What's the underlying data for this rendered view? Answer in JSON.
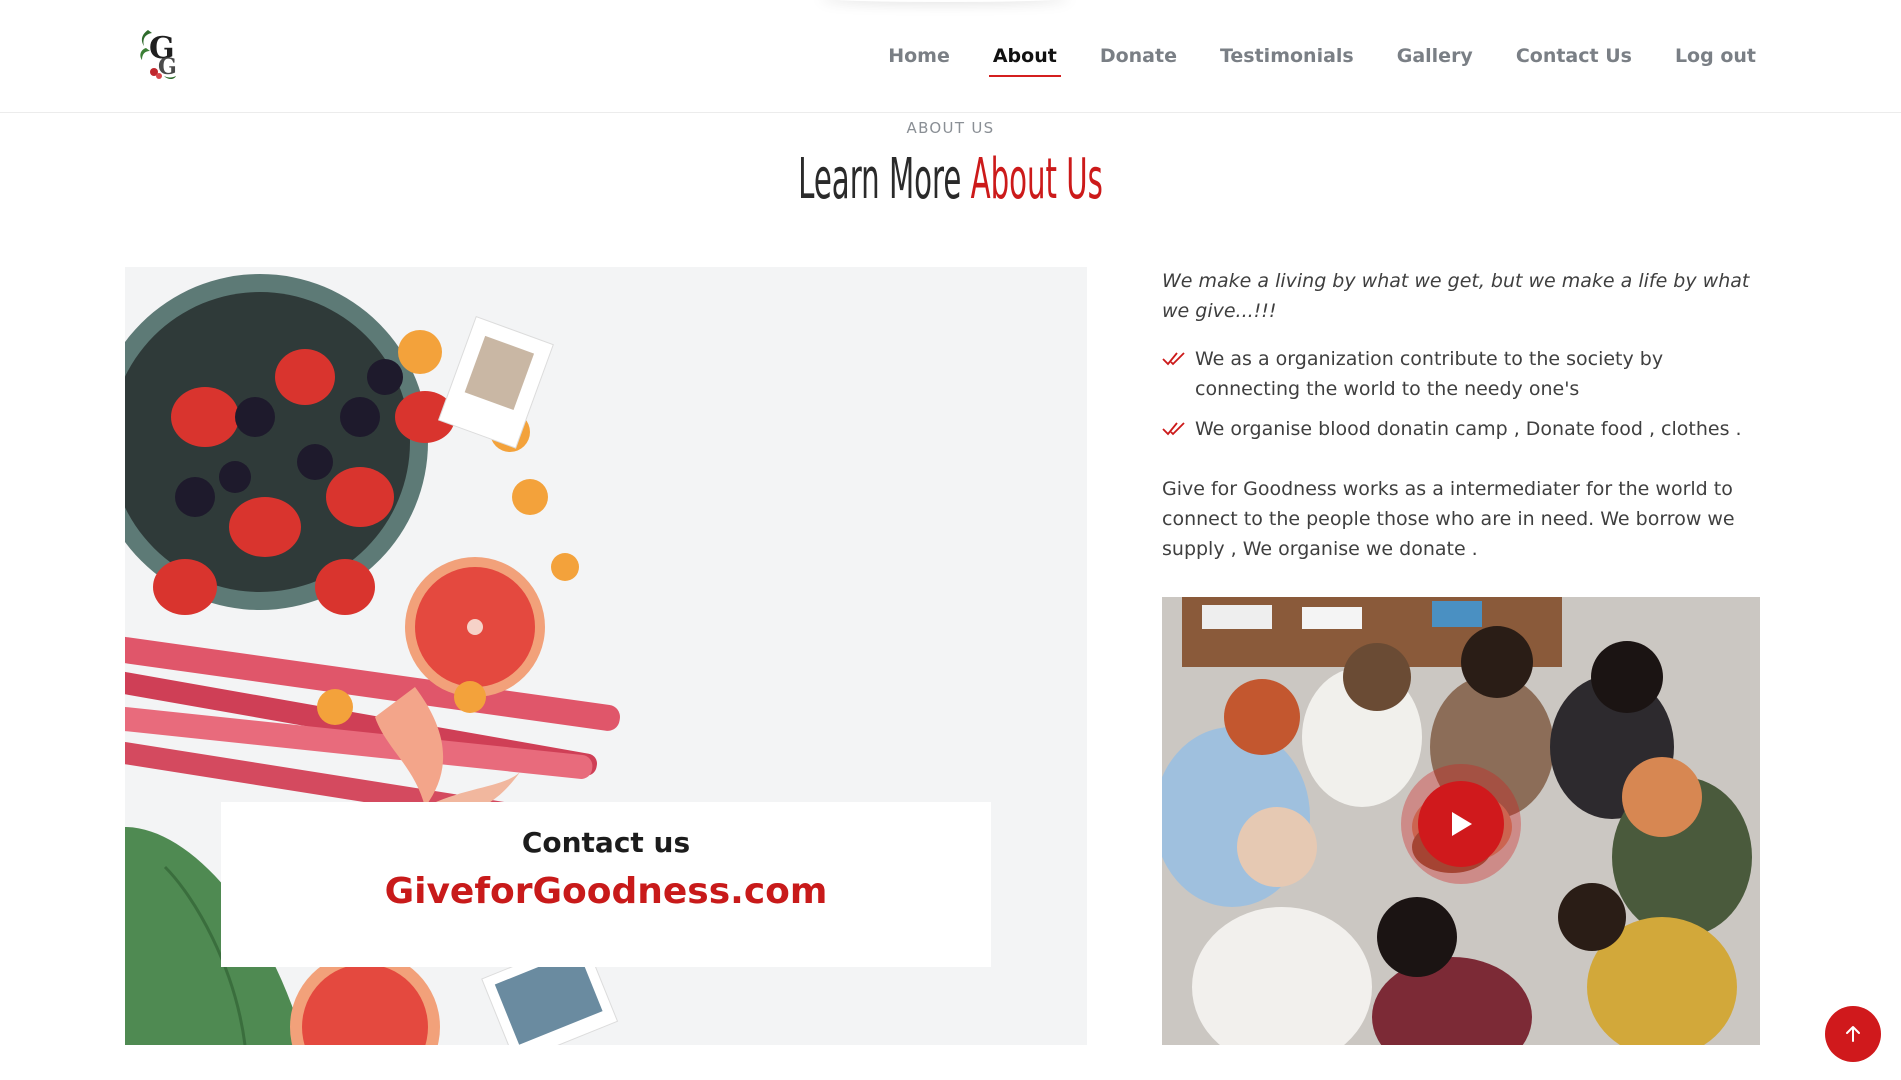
{
  "header": {
    "logo_icon": "leaf-G-monogram-icon",
    "nav": [
      {
        "label": "Home",
        "active": false
      },
      {
        "label": "About",
        "active": true
      },
      {
        "label": "Donate",
        "active": false
      },
      {
        "label": "Testimonials",
        "active": false
      },
      {
        "label": "Gallery",
        "active": false
      },
      {
        "label": "Contact Us",
        "active": false
      },
      {
        "label": "Log out",
        "active": false
      }
    ]
  },
  "section": {
    "eyebrow": "ABOUT US",
    "title_main": "Learn More ",
    "title_accent": "About Us"
  },
  "contact_card": {
    "title": "Contact us",
    "site": "GiveforGoodness.com"
  },
  "about": {
    "quote": "We make a living by what we get, but we make a life by what we give...!!!",
    "bullets": [
      "We as a organization contribute to the society by connecting the world to the needy one's",
      "We organise blood donatin camp , Donate food , clothes ."
    ],
    "paragraph": "Give for Goodness works as a intermediater for the world to connect to the people those who are in need. We borrow we supply , We organise we donate ."
  },
  "icons": {
    "bullet": "double-check-icon",
    "video": "play-icon",
    "back_to_top": "arrow-up-icon"
  },
  "colors": {
    "accent": "#d0191c",
    "nav_text": "#7a7f85",
    "nav_active": "#111111"
  }
}
